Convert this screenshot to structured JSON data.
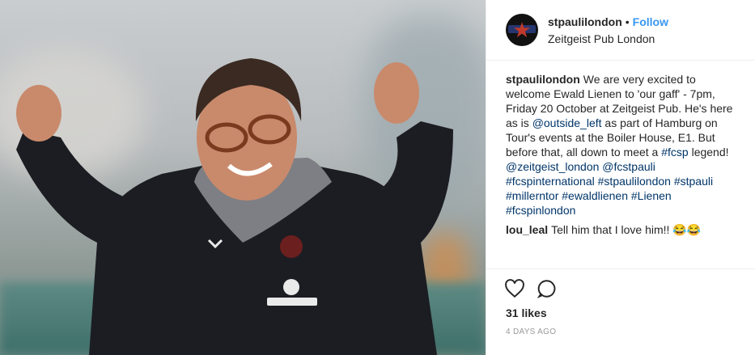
{
  "post": {
    "photo_alt_subject": "man-cheering-photo"
  },
  "header": {
    "username": "stpaulilondon",
    "separator": "•",
    "follow_label": "Follow",
    "location": "Zeitgeist Pub London"
  },
  "caption": {
    "username": "stpaulilondon",
    "text_1": "We are very excited to welcome Ewald Lienen to 'our gaff' - 7pm, Friday 20 October at Zeitgeist Pub. He's here as is ",
    "mention_1": "@outside_left",
    "text_2": " as part of Hamburg on Tour's events at the Boiler House, E1. But before that, all down to meet a ",
    "tag_fcsp": "#fcsp",
    "text_3": " legend! ",
    "mention_2": "@zeitgeist_london",
    "mention_3": "@fcstpauli",
    "tags": [
      "#fcspinternational",
      "#stpaulilondon",
      "#stpauli",
      "#millerntor",
      "#ewaldlienen",
      "#Lienen",
      "#fcspinlondon"
    ]
  },
  "comment": {
    "username": "lou_leal",
    "text": "Tell him that I love him!! 😂😂"
  },
  "footer": {
    "likes": "31 likes",
    "date": "4 DAYS AGO"
  }
}
